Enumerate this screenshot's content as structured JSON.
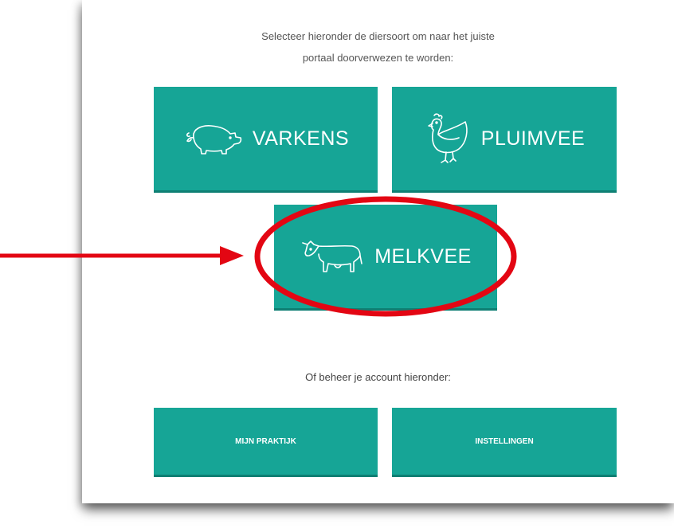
{
  "intro": {
    "line1": "Selecteer hieronder de diersoort om naar het juiste",
    "line2": "portaal doorverwezen te worden:"
  },
  "species": [
    {
      "label": "VARKENS",
      "icon": "pig-icon"
    },
    {
      "label": "PLUIMVEE",
      "icon": "chicken-icon"
    },
    {
      "label": "MELKVEE",
      "icon": "cow-icon"
    }
  ],
  "account": {
    "heading": "Of beheer je account hieronder:",
    "buttons": [
      {
        "label": "MIJN PRAKTIJK"
      },
      {
        "label": "INSTELLINGEN"
      }
    ]
  },
  "colors": {
    "tile": "#16a596",
    "annotation": "#e30613"
  }
}
